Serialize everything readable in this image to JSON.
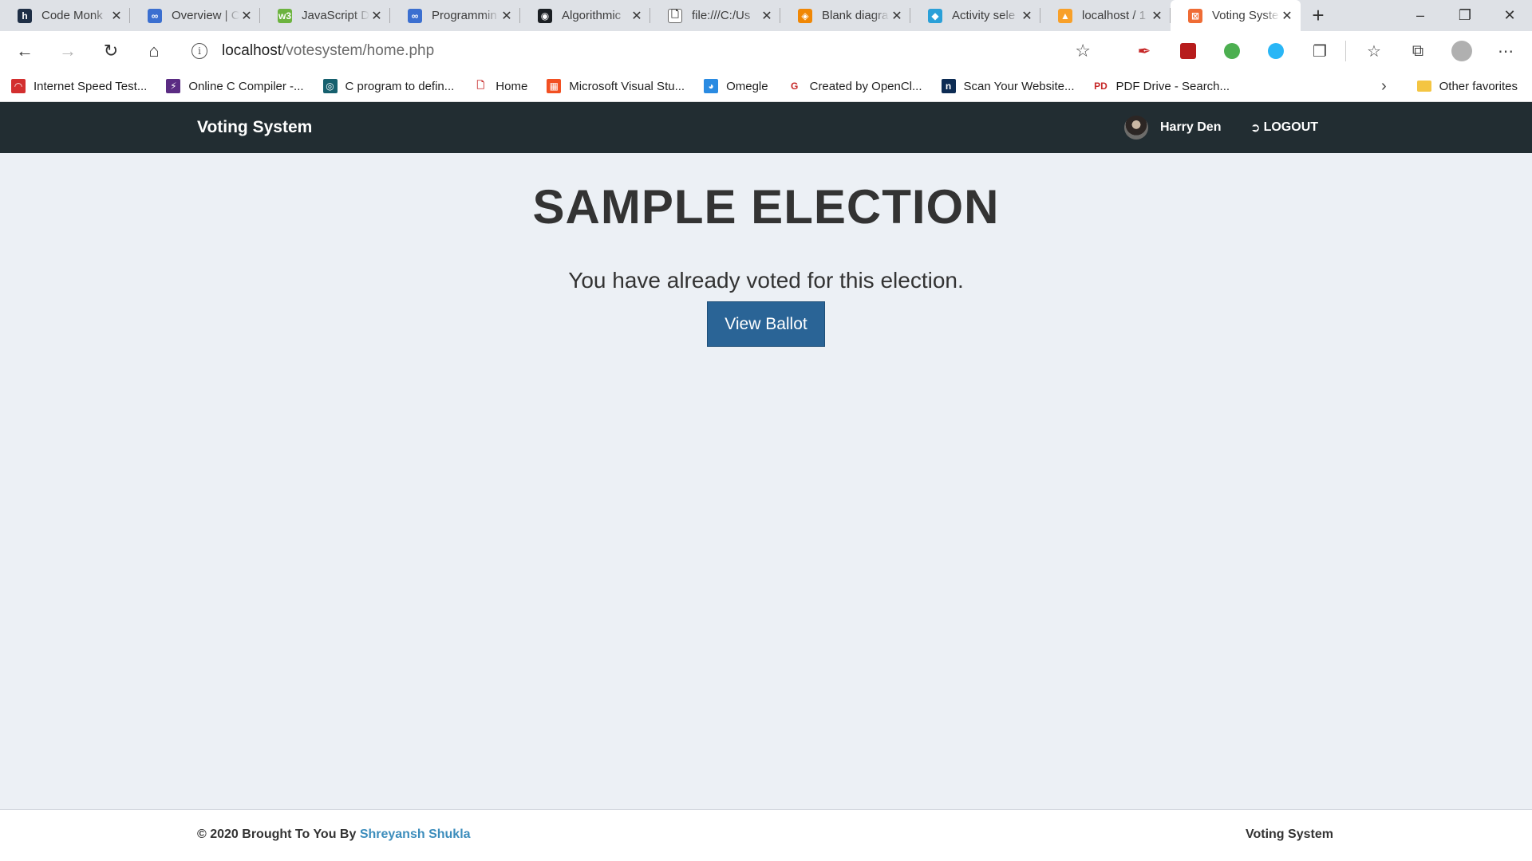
{
  "browser": {
    "tabs": [
      {
        "title": "Code Monk",
        "favicon": "h",
        "favicon_color": "#1f2f46"
      },
      {
        "title": "Overview | C",
        "favicon": "∞",
        "favicon_color": "#3b6fd0"
      },
      {
        "title": "JavaScript D",
        "favicon": "w3",
        "favicon_color": "#6cb33f"
      },
      {
        "title": "Programmin",
        "favicon": "∞",
        "favicon_color": "#3b6fd0"
      },
      {
        "title": "Algorithmic",
        "favicon": "◉",
        "favicon_color": "#1b1f23"
      },
      {
        "title": "file:///C:/Us",
        "favicon": "🗋",
        "favicon_color": "#ffffff"
      },
      {
        "title": "Blank diagra",
        "favicon": "◈",
        "favicon_color": "#f08705"
      },
      {
        "title": "Activity sele",
        "favicon": "◆",
        "favicon_color": "#2aa0d8"
      },
      {
        "title": "localhost / 1",
        "favicon": "▲",
        "favicon_color": "#f8a029"
      },
      {
        "title": "Voting Syste",
        "favicon": "⊠",
        "favicon_color": "#ef6c35"
      }
    ],
    "new_tab": "+",
    "url_host": "localhost",
    "url_path": "/votesystem/home.php",
    "bookmarks": [
      {
        "label": "Internet Speed Test...",
        "color": "#d32f2f",
        "glyph": "◠"
      },
      {
        "label": "Online C Compiler -...",
        "color": "#5b2c83",
        "glyph": "⚡"
      },
      {
        "label": "C program to defin...",
        "color": "#16606e",
        "glyph": "◎"
      },
      {
        "label": "Home",
        "color": "#ffffff",
        "glyph": "🗋"
      },
      {
        "label": "Microsoft Visual Stu...",
        "color": "#f25022",
        "glyph": "▦"
      },
      {
        "label": "Omegle",
        "color": "#2a8be2",
        "glyph": "◕"
      },
      {
        "label": "Created by OpenCl...",
        "color": "#ffffff",
        "glyph": "G"
      },
      {
        "label": "Scan Your Website...",
        "color": "#0d2c54",
        "glyph": "n"
      },
      {
        "label": "PDF Drive - Search...",
        "color": "#ffffff",
        "glyph": "PD"
      }
    ],
    "other_favorites": "Other favorites"
  },
  "navbar": {
    "brand": "Voting System",
    "user_name": "Harry Den",
    "logout": "LOGOUT"
  },
  "main": {
    "election_title": "SAMPLE ELECTION",
    "notice": "You have already voted for this election.",
    "view_ballot": "View Ballot"
  },
  "footer": {
    "copyright": "© 2020 Brought To You By ",
    "author": "Shreyansh Shukla",
    "app_name": "Voting System"
  },
  "colors": {
    "navbar_bg": "#222d32",
    "page_bg": "#ecf0f5",
    "button_bg": "#2a6496",
    "link": "#3c8dbc"
  }
}
